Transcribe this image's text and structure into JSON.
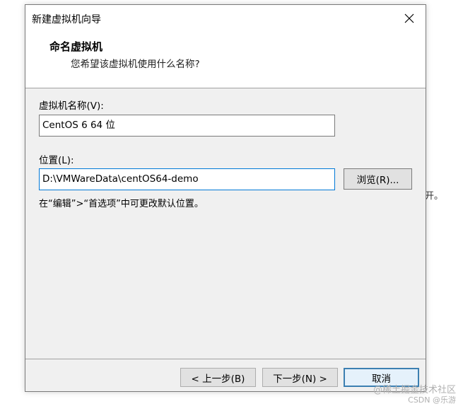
{
  "window": {
    "title": "新建虚拟机向导"
  },
  "header": {
    "title": "命名虚拟机",
    "subtitle": "您希望该虚拟机使用什么名称?"
  },
  "form": {
    "name_label": "虚拟机名称(V):",
    "name_value": "CentOS 6 64 位",
    "location_label": "位置(L):",
    "location_value": "D:\\VMWareData\\centOS64-demo",
    "browse_label": "浏览(R)...",
    "hint": "在“编辑”>“首选项”中可更改默认位置。"
  },
  "footer": {
    "back_label": "< 上一步(B)",
    "next_label": "下一步(N) >",
    "cancel_label": "取消"
  },
  "background_text": "开。",
  "watermark": {
    "line1": "@稀土掘金技术社区",
    "line2": "CSDN @乐游"
  },
  "icons": {
    "close": "close-icon"
  }
}
